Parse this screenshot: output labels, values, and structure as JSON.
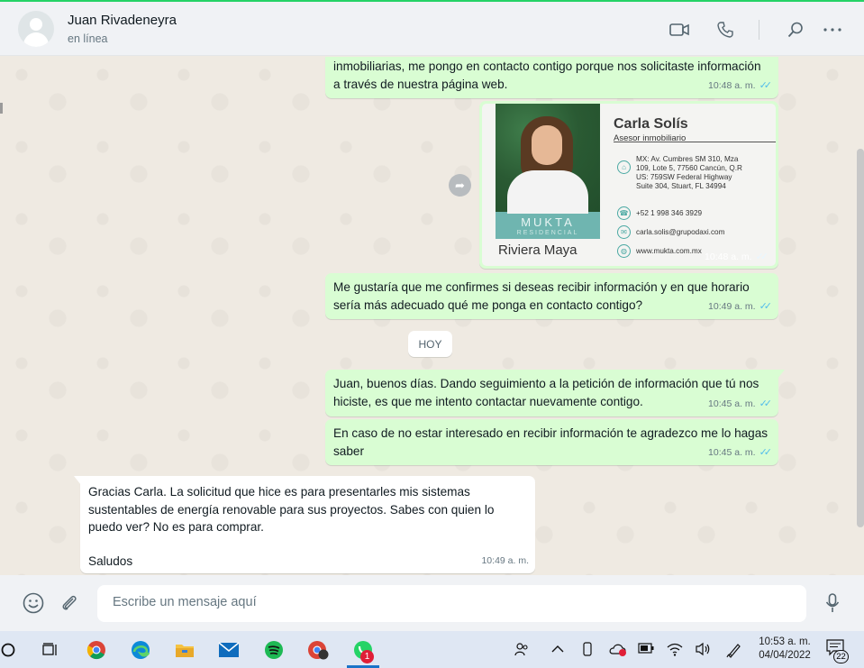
{
  "header": {
    "contact_name": "Juan Rivadeneyra",
    "status": "en línea"
  },
  "messages": [
    {
      "dir": "out",
      "text": "inmobiliarias, me pongo en contacto contigo porque nos solicitaste información a través de nuestra página web.",
      "time": "10:48 a. m.",
      "read": true
    },
    {
      "dir": "out",
      "type": "image",
      "time": "10:48 a. m.",
      "read": true
    },
    {
      "dir": "out",
      "text": "Me gustaría que me confirmes si deseas recibir información y en que horario sería más adecuado qué me ponga en contacto contigo?",
      "time": "10:49 a. m.",
      "read": true
    },
    {
      "dir": "out",
      "text": "Juan, buenos días. Dando seguimiento a la petición de información que tú nos hiciste, es que  me intento contactar nuevamente contigo.",
      "time": "10:45 a. m.",
      "read": true
    },
    {
      "dir": "out",
      "text": "En caso de no estar interesado en recibir información te agradezco me lo hagas saber",
      "time": "10:45 a. m.",
      "read": true
    },
    {
      "dir": "in",
      "text": "Gracias Carla. La solicitud que hice es para presentarles mis sistemas sustentables de energía renovable para sus proyectos. Sabes con quien lo puedo ver? No es para comprar.",
      "text2": "Saludos",
      "time": "10:49 a. m."
    }
  ],
  "date_divider": "HOY",
  "business_card": {
    "name": "Carla Solís",
    "role": "Asesor inmobiliario",
    "address": [
      "MX: Av. Cumbres SM 310, Mza",
      "109, Lote 5, 77560 Cancún, Q.R",
      "US: 759SW Federal Highway",
      "Suite 304, Stuart, FL 34994"
    ],
    "phone": "+52 1 998 346 3929",
    "email": "carla.solis@grupodaxi.com",
    "web": "www.mukta.com.mx",
    "brand": "MUKTA",
    "brand_sub": "RESIDENCIAL",
    "location": "Riviera Maya"
  },
  "composer": {
    "placeholder": "Escribe un mensaje aquí"
  },
  "taskbar": {
    "time": "10:53 a. m.",
    "date": "04/04/2022",
    "whatsapp_badge": "1",
    "notifications": "22"
  },
  "colors": {
    "outgoing_bubble": "#d9fdd3",
    "incoming_bubble": "#ffffff",
    "read_ticks": "#53bdeb",
    "chat_background": "#efeae2"
  }
}
